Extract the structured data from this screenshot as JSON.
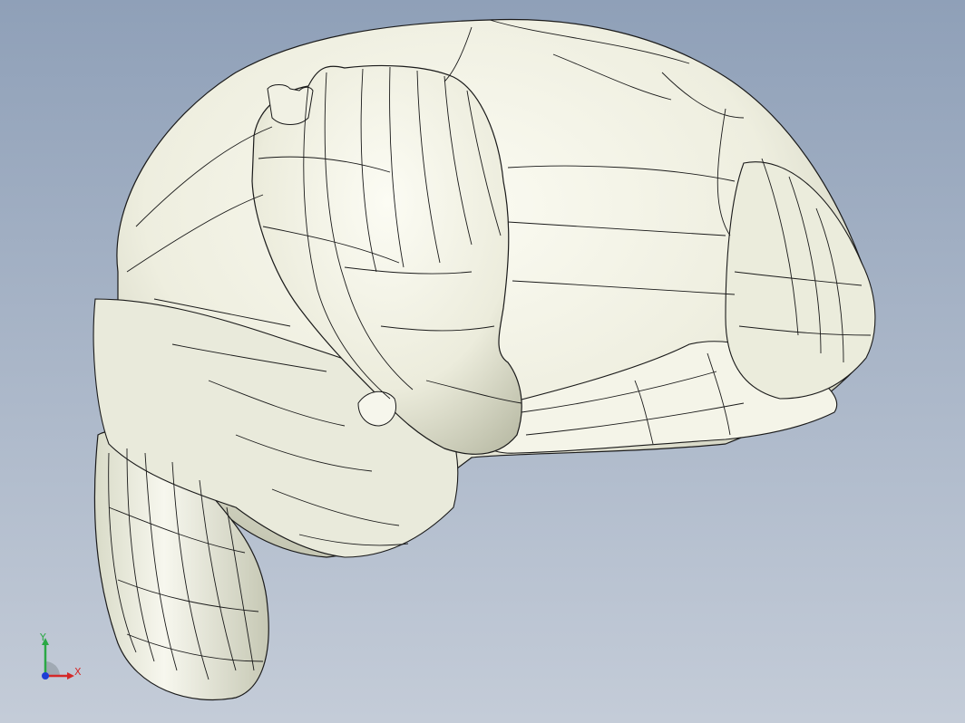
{
  "viewport": {
    "background_top": "#8fa0b8",
    "background_bottom": "#c2cad6",
    "model_fill": "#f2f2e4",
    "model_shade": "#c9cbb8",
    "edge_color": "#1a1a1a"
  },
  "triad": {
    "x_label": "X",
    "y_label": "Y",
    "x_color": "#d42828",
    "y_color": "#2aa845",
    "z_color": "#1f3fd6"
  }
}
